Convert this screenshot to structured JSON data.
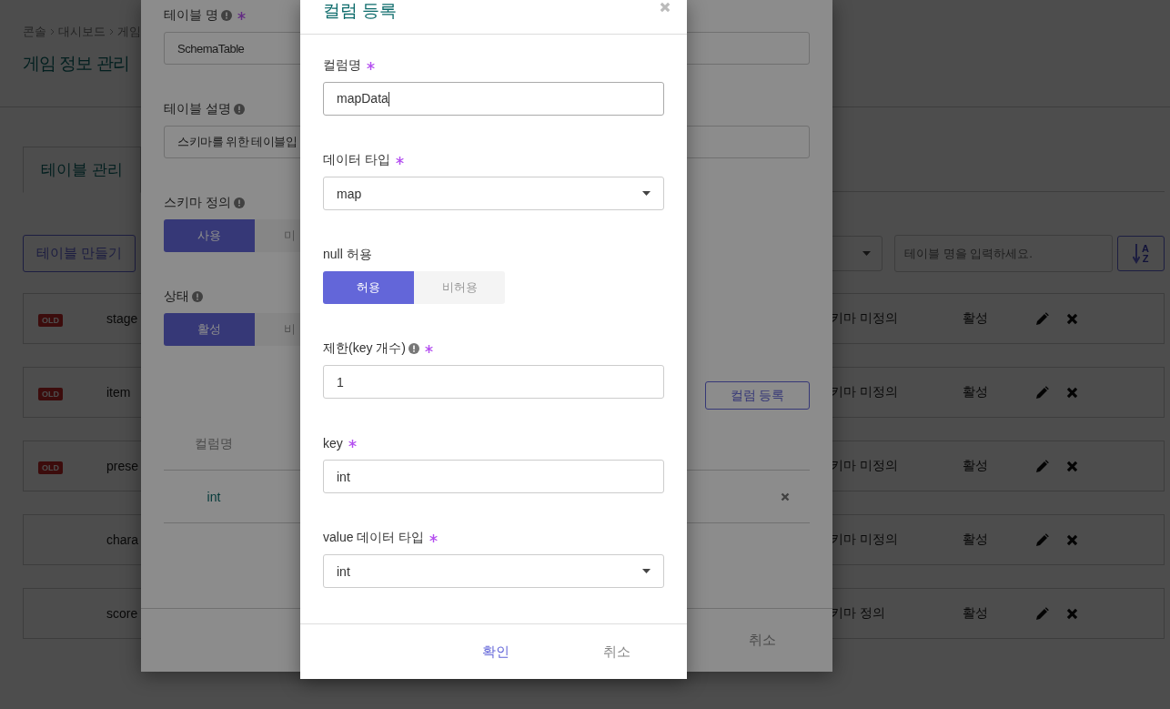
{
  "breadcrumb": [
    "콘솔",
    "대시보드",
    "게임"
  ],
  "page_title": "게임 정보 관리",
  "tabs": [
    {
      "label": "테이블 관리",
      "selected": true
    }
  ],
  "create_button": "테이블 만들기",
  "search": {
    "placeholder": "테이블 명을 입력하세요."
  },
  "sort_button": {
    "top_letter": "A",
    "bottom_letter": "Z"
  },
  "tables": [
    {
      "badge": "OLD",
      "name": "stage",
      "schema": "키마 미정의",
      "status": "활성"
    },
    {
      "badge": "OLD",
      "name": "item",
      "schema": "키마 미정의",
      "status": "활성"
    },
    {
      "badge": "OLD",
      "name": "prese",
      "schema": "키마 미정의",
      "status": "활성"
    },
    {
      "name": "chara",
      "schema": "키마 미정의",
      "status": "활성"
    },
    {
      "name": "score",
      "schema": "키마 정의",
      "status": "활성"
    }
  ],
  "table_modal": {
    "fields": [
      {
        "kind": "input",
        "label": "테이블 명",
        "info": true,
        "required": true,
        "value": "SchemaTable"
      },
      {
        "kind": "input",
        "label": "테이블 설명",
        "info": true,
        "value": "스키마를 위한 테이블입"
      },
      {
        "kind": "toggle",
        "label": "스키마 정의",
        "info": true,
        "options": [
          {
            "label": "사용",
            "selected": true
          },
          {
            "label": "미",
            "selected": false
          }
        ]
      },
      {
        "kind": "toggle",
        "label": "상태",
        "info": true,
        "options": [
          {
            "label": "활성",
            "selected": true
          },
          {
            "label": "비",
            "selected": false
          }
        ]
      }
    ],
    "add_column_button": "컬럼 등록",
    "columns_header": [
      "컬럼명"
    ],
    "columns_rows": [
      [
        "int"
      ]
    ],
    "cancel_button": "취소"
  },
  "column_modal": {
    "title": "컬럼 등록",
    "fields": [
      {
        "kind": "input",
        "label": "컬럼명",
        "required": true,
        "value": "mapData",
        "focused": true
      },
      {
        "kind": "select",
        "label": "데이터 타입",
        "required": true,
        "value": "map"
      },
      {
        "kind": "toggle",
        "label": "null 허용",
        "options": [
          {
            "label": "허용",
            "selected": true
          },
          {
            "label": "비허용",
            "selected": false
          }
        ]
      },
      {
        "kind": "input",
        "label": "제한(key 개수)",
        "info": true,
        "required": true,
        "value": "1",
        "focused": false
      },
      {
        "kind": "input",
        "label": "key",
        "required": true,
        "value": "int",
        "focused": false
      },
      {
        "kind": "select",
        "label": "value 데이터 타입",
        "required": true,
        "value": "int"
      }
    ],
    "buttons": [
      {
        "label": "확인",
        "kind": "primary"
      },
      {
        "label": "취소",
        "kind": "secondary"
      }
    ]
  }
}
